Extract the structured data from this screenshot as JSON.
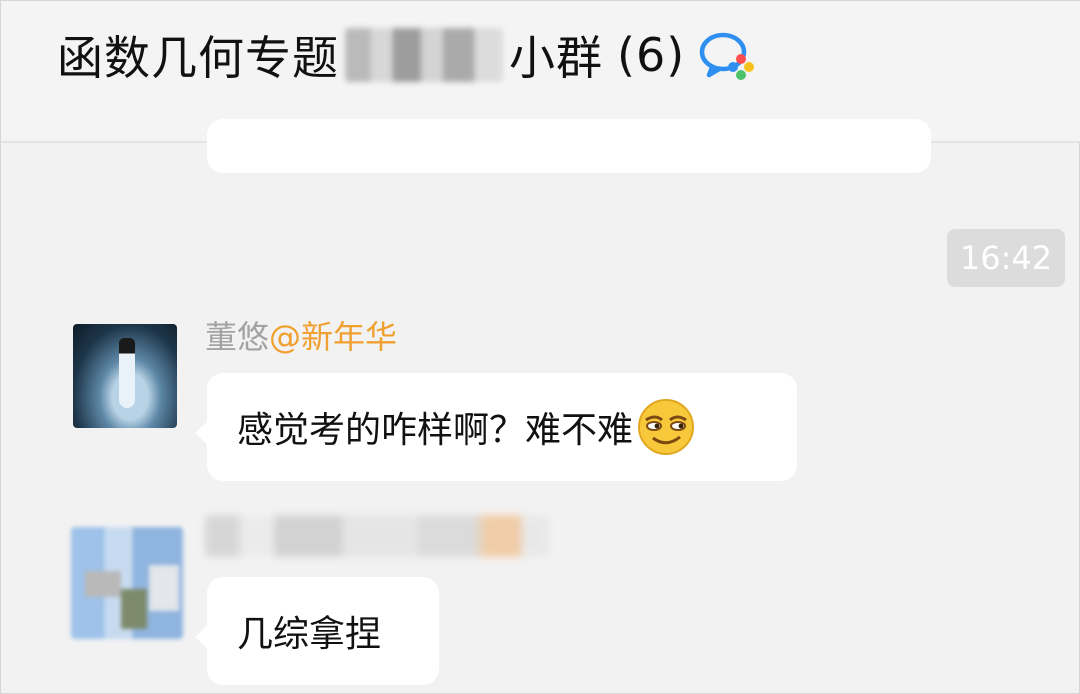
{
  "header": {
    "title_prefix": "函数几何专题",
    "title_suffix": "小群",
    "member_count": "(6)",
    "icon": "chat-bubble-icon"
  },
  "messages": [
    {
      "type": "bubble",
      "text": ""
    },
    {
      "type": "time",
      "text": "16:42"
    },
    {
      "type": "bubble",
      "sender": "董悠",
      "mention": "@新年华",
      "text": "感觉考的咋样啊？难不难",
      "emoji": "smirk-emoji"
    },
    {
      "type": "bubble",
      "sender_blurred": true,
      "text": "几综拿捏"
    }
  ],
  "colors": {
    "background": "#f2f2f2",
    "bubble": "#ffffff",
    "mention": "#f0a030",
    "sender": "#a3a3a3",
    "time_pill": "#dcdcdc"
  }
}
